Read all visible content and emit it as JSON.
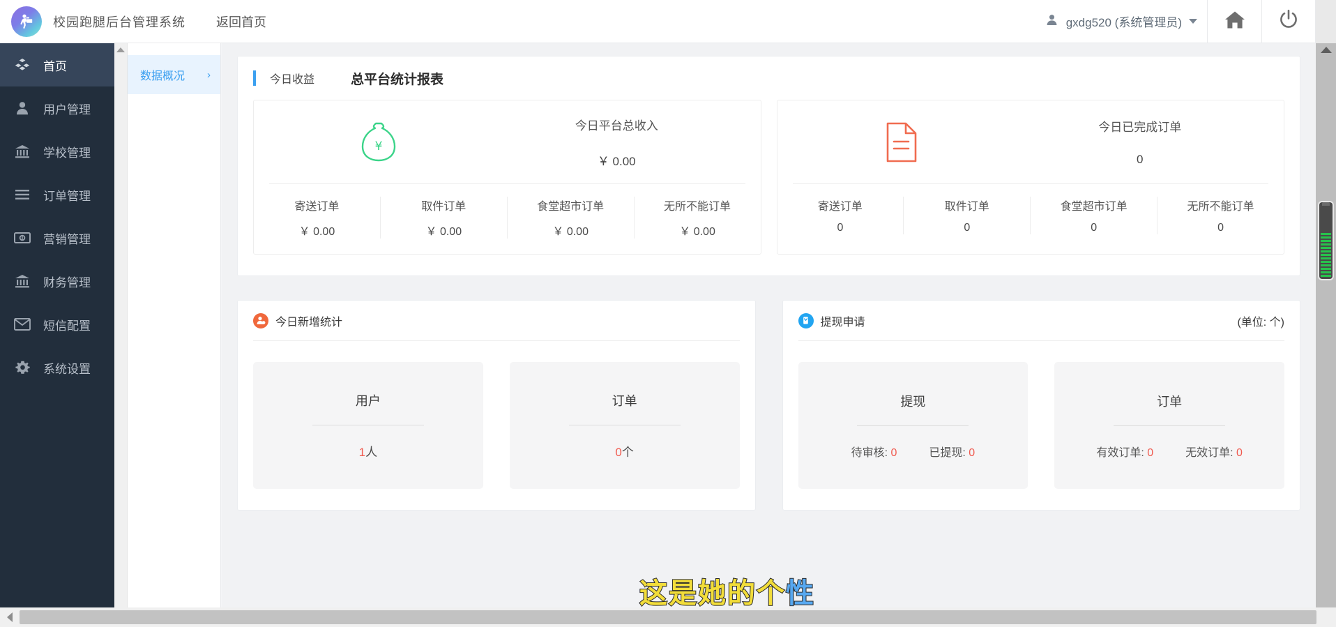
{
  "header": {
    "logo_icon": "courier-logo-icon",
    "brand_title": "校园跑腿后台管理系统",
    "home_link": "返回首页",
    "user_icon": "user-icon",
    "user_name": "gxdg520 (系统管理员)",
    "home_icon": "home-icon",
    "power_icon": "power-icon"
  },
  "sidebar": {
    "items": [
      {
        "label": "首页",
        "icon": "cubes-icon",
        "active": true
      },
      {
        "label": "用户管理",
        "icon": "user-icon",
        "active": false
      },
      {
        "label": "学校管理",
        "icon": "bank-icon",
        "active": false
      },
      {
        "label": "订单管理",
        "icon": "list-icon",
        "active": false
      },
      {
        "label": "营销管理",
        "icon": "money-icon",
        "active": false
      },
      {
        "label": "财务管理",
        "icon": "bank-icon",
        "active": false
      },
      {
        "label": "短信配置",
        "icon": "envelope-icon",
        "active": false
      },
      {
        "label": "系统设置",
        "icon": "gear-icon",
        "active": false
      }
    ]
  },
  "subnav": {
    "items": [
      {
        "label": "数据概况",
        "chevron": "›",
        "active": true
      }
    ]
  },
  "report": {
    "tag_label": "今日收益",
    "title": "总平台统计报表",
    "cards": [
      {
        "icon": "money-bag-icon",
        "icon_color": "#3bd489",
        "label": "今日平台总收入",
        "value": "￥ 0.00",
        "breakdown": [
          {
            "label": "寄送订单",
            "value": "￥ 0.00"
          },
          {
            "label": "取件订单",
            "value": "￥ 0.00"
          },
          {
            "label": "食堂超市订单",
            "value": "￥ 0.00"
          },
          {
            "label": "无所不能订单",
            "value": "￥ 0.00"
          }
        ]
      },
      {
        "icon": "document-icon",
        "icon_color": "#f06c50",
        "label": "今日已完成订单",
        "value": "0",
        "breakdown": [
          {
            "label": "寄送订单",
            "value": "0"
          },
          {
            "label": "取件订单",
            "value": "0"
          },
          {
            "label": "食堂超市订单",
            "value": "0"
          },
          {
            "label": "无所不能订单",
            "value": "0"
          }
        ]
      }
    ]
  },
  "new_stats": {
    "icon": "user-badge-icon",
    "icon_color": "#f0683c",
    "title": "今日新增统计",
    "tiles": [
      {
        "title": "用户",
        "value": "1",
        "unit": "人"
      },
      {
        "title": "订单",
        "value": "0",
        "unit": "个"
      }
    ]
  },
  "withdraw": {
    "icon": "withdraw-badge-icon",
    "icon_color": "#22a5f1",
    "title": "提现申请",
    "unit_note": "(单位: 个)",
    "tiles": [
      {
        "title": "提现",
        "metrics": [
          {
            "label": "待审核:",
            "value": "0"
          },
          {
            "label": "已提现:",
            "value": "0"
          }
        ]
      },
      {
        "title": "订单",
        "metrics": [
          {
            "label": "有效订单:",
            "value": "0"
          },
          {
            "label": "无效订单:",
            "value": "0"
          }
        ]
      }
    ]
  },
  "watermark": {
    "text_yellow": "这是她的个",
    "text_blue": "性"
  },
  "colors": {
    "accent_blue": "#3ca0f0",
    "sidebar_bg": "#222e3c",
    "sidebar_active": "#36455a",
    "danger_red": "#f05a4f",
    "green": "#3bd489",
    "orange": "#f0683c"
  }
}
